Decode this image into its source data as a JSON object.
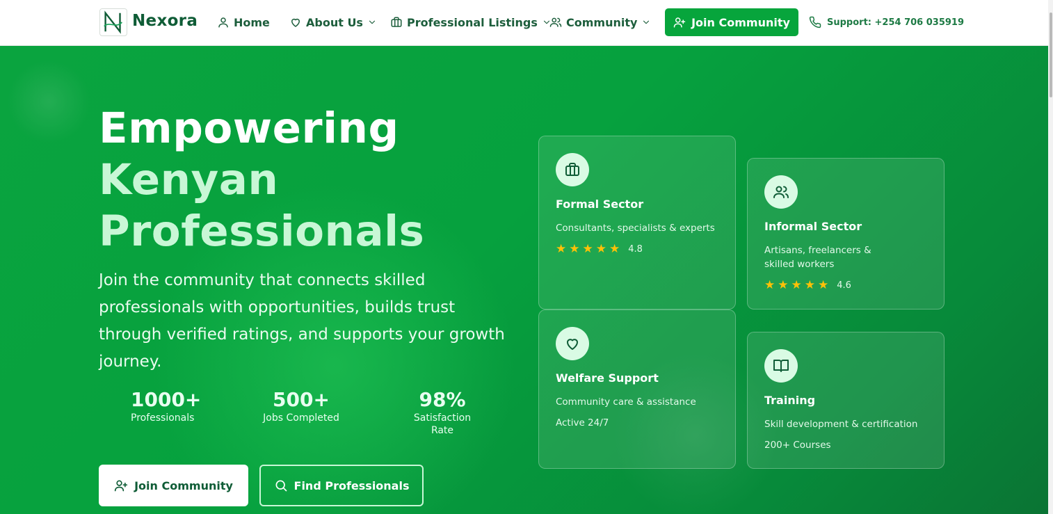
{
  "header": {
    "brand": "Nexora",
    "nav": [
      {
        "label": "Home",
        "icon": "user-icon"
      },
      {
        "label": "About Us",
        "icon": "heart-icon"
      },
      {
        "label": "Professional Listings",
        "icon": "briefcase-icon"
      },
      {
        "label": "Community",
        "icon": "users-icon"
      }
    ],
    "join_button": "Join Community",
    "support": "Support: +254 706 035919"
  },
  "hero": {
    "headline_line1": "Empowering",
    "headline_line2": "Kenyan",
    "headline_line3": "Professionals",
    "subtitle": "Join the community that connects skilled professionals with opportunities, builds trust through verified ratings, and supports your growth journey.",
    "stats": [
      {
        "value": "1000+",
        "label": "Professionals"
      },
      {
        "value": "500+",
        "label": "Jobs Completed"
      },
      {
        "value": "98%",
        "label": "Satisfaction Rate"
      }
    ],
    "primary_button": "Join Community",
    "secondary_button": "Find Professionals"
  },
  "cards": [
    {
      "title": "Formal Sector",
      "description": "Consultants, specialists & experts",
      "rating": "4.8",
      "stars": 5,
      "icon": "briefcase-icon"
    },
    {
      "title": "Informal Sector",
      "description": "Artisans, freelancers & skilled workers",
      "rating": "4.6",
      "stars": 5,
      "icon": "users-icon"
    },
    {
      "title": "Welfare Support",
      "description": "Community care & assistance",
      "extra": "Active 24/7",
      "icon": "heart-icon"
    },
    {
      "title": "Training",
      "description": "Skill development & certification",
      "extra": "200+ Courses",
      "icon": "book-icon"
    }
  ],
  "colors": {
    "accent": "#07a53c",
    "brand_dark": "#0f5c36",
    "star": "#ffc107",
    "headline_light": "#c8f7d6"
  }
}
